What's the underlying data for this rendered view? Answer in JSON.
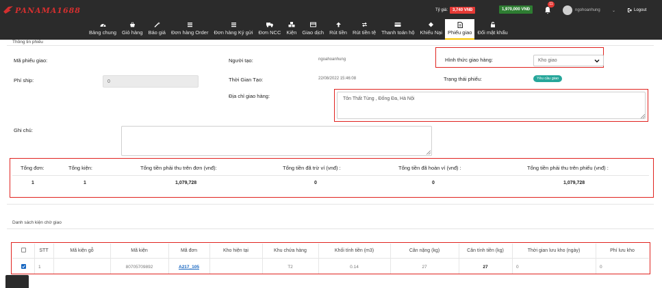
{
  "brand": {
    "logo_text": "PANAMA1688"
  },
  "header": {
    "rate_label": "Tỷ giá:",
    "rate_value": "3,740 VNĐ",
    "balance": "1,970,000 VNĐ",
    "notification_count": "11",
    "username": "ngohoanhung",
    "logout_label": "Logout"
  },
  "nav": [
    {
      "label": "Bảng chung",
      "icon": "dashboard-icon"
    },
    {
      "label": "Giỏ hàng",
      "icon": "basket-icon"
    },
    {
      "label": "Báo giá",
      "icon": "magic-icon"
    },
    {
      "label": "Đơn hàng Order",
      "icon": "list-icon"
    },
    {
      "label": "Đơn hàng Ký gửi",
      "icon": "list-icon"
    },
    {
      "label": "Đơn NCC",
      "icon": "truck-icon"
    },
    {
      "label": "Kiện",
      "icon": "cubes-icon"
    },
    {
      "label": "Giao dịch",
      "icon": "card-icon"
    },
    {
      "label": "Rút tiền",
      "icon": "arrow-up-icon"
    },
    {
      "label": "Rút tiền tệ",
      "icon": "exchange-icon"
    },
    {
      "label": "Thanh toán hộ",
      "icon": "credit-card-icon"
    },
    {
      "label": "Khiếu Nại",
      "icon": "diamond-icon"
    },
    {
      "label": "Phiếu giao",
      "icon": "document-icon",
      "active": true
    },
    {
      "label": "Đổi mật khẩu",
      "icon": "lock-icon"
    }
  ],
  "form": {
    "panel_title": "Thông tin phiếu",
    "ma_phieu_label": "Mã phiếu giao:",
    "phi_ship_label": "Phí ship:",
    "phi_ship_value": "0",
    "nguoi_tao_label": "Người tạo:",
    "nguoi_tao_value": "ngoahoanhung",
    "thoi_gian_label": "Thời Gian Tạo:",
    "thoi_gian_value": "22/08/2022 15:46:08",
    "dia_chi_label": "Địa chỉ giao hàng:",
    "dia_chi_value": "Tôn Thất Tùng , Đống Đa, Hà Nội",
    "hinh_thuc_label": "Hình thức giao hàng:",
    "hinh_thuc_value": "Kho giao",
    "trang_thai_label": "Trạng thái phiếu:",
    "trang_thai_value": "Yêu cầu giao",
    "ghi_chu_label": "Ghi chú:"
  },
  "summary": {
    "headers": [
      "Tổng đơn:",
      "Tổng kiện:",
      "Tổng tiền phải thu trên đơn (vnđ):",
      "Tổng tiền đã trừ ví (vnđ) :",
      "Tổng tiền đã hoàn ví (vnđ) :",
      "Tổng tiền phải thu trên phiếu (vnđ) :"
    ],
    "values": [
      "1",
      "1",
      "1,079,728",
      "0",
      "0",
      "1,079,728"
    ]
  },
  "packages": {
    "title": "Danh sách kiện chờ giao",
    "columns": [
      "STT",
      "Mã kiện gỗ",
      "Mã kiện",
      "Mã đơn",
      "Kho hiện tại",
      "Khu chứa hàng",
      "Khối tính tiền (m3)",
      "Cân nặng (kg)",
      "Cân tính tiền (kg)",
      "Thời gian lưu kho (ngày)",
      "Phí lưu kho"
    ],
    "rows": [
      {
        "stt": "1",
        "ma_kien_go": "",
        "ma_kien": "80705709892",
        "ma_don": "A217_105",
        "kho": "",
        "khu": "T2",
        "khoi": "0.14",
        "can_nang": "27",
        "can_tinh": "27",
        "thoi_gian": "0",
        "phi": "0"
      }
    ]
  },
  "colors": {
    "header_bg": "#2b2b2b",
    "accent_red": "#e0201c",
    "active_tab_underline": "#f5c400",
    "status_green": "#26a69a"
  }
}
